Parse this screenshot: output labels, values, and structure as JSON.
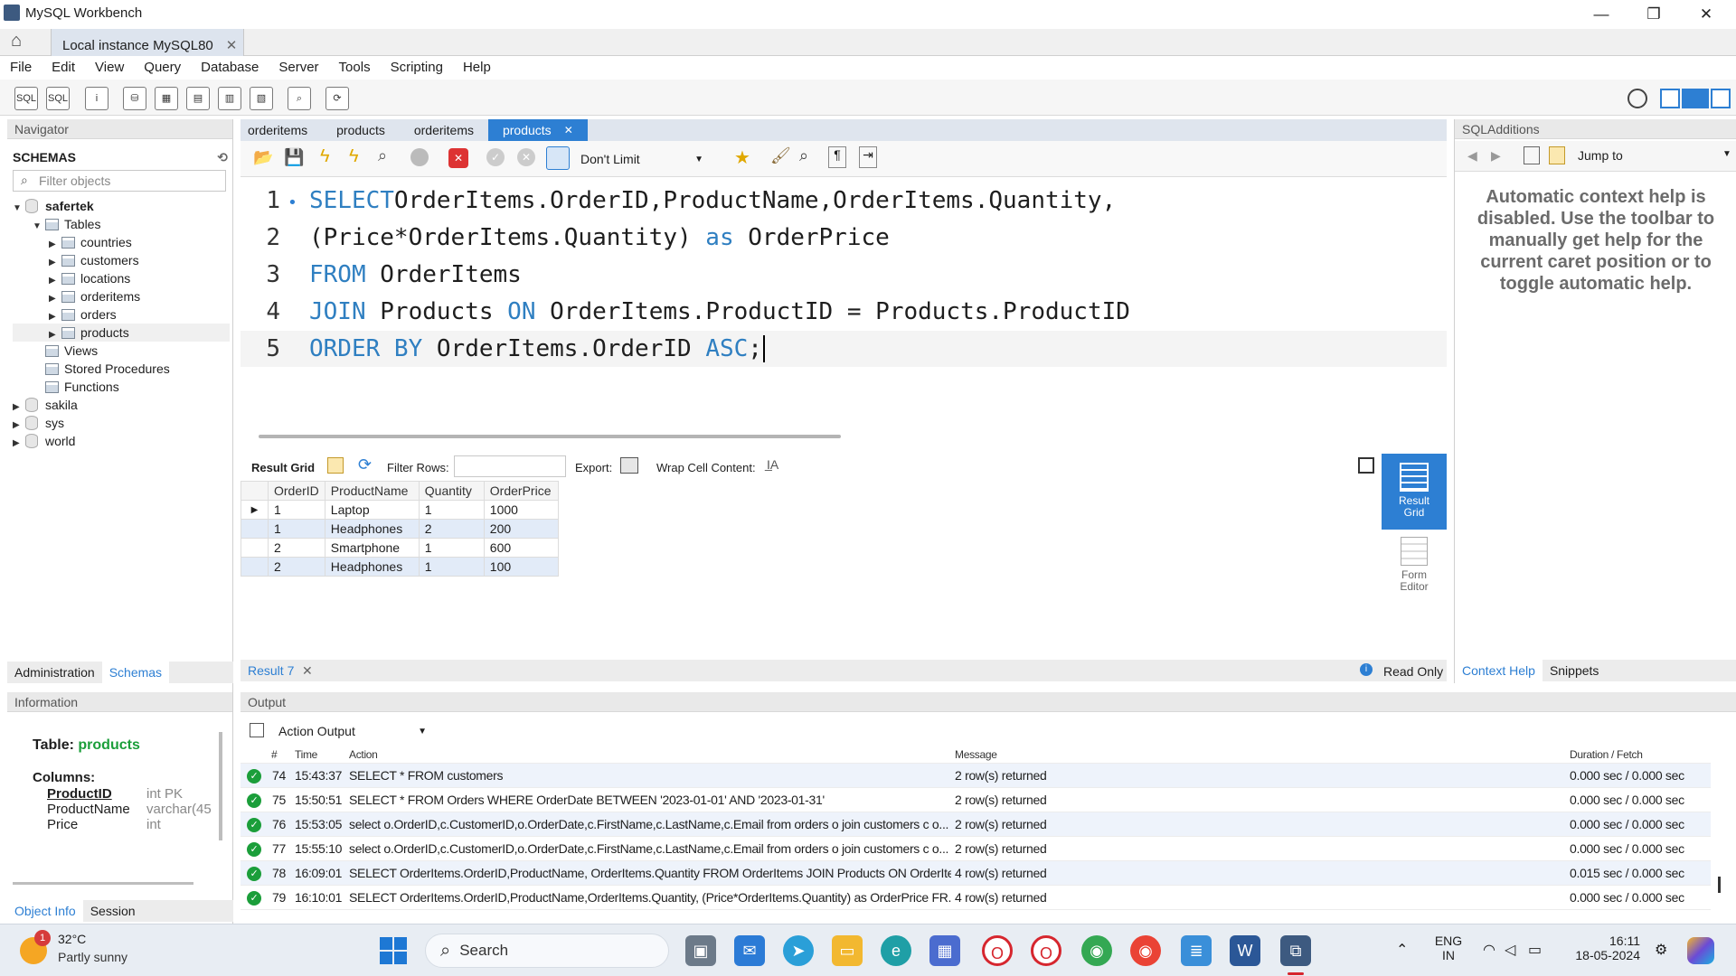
{
  "window": {
    "title": "MySQL Workbench",
    "conn_tab": "Local instance MySQL80"
  },
  "menu": [
    "File",
    "Edit",
    "View",
    "Query",
    "Database",
    "Server",
    "Tools",
    "Scripting",
    "Help"
  ],
  "navigator": {
    "header": "Navigator",
    "schemas_label": "SCHEMAS",
    "filter_placeholder": "Filter objects",
    "schema": "safertek",
    "tables_label": "Tables",
    "tables": [
      "countries",
      "customers",
      "locations",
      "orderitems",
      "orders",
      "products"
    ],
    "views_label": "Views",
    "procs_label": "Stored Procedures",
    "funcs_label": "Functions",
    "other_schemas": [
      "sakila",
      "sys",
      "world"
    ],
    "tabs": [
      "Administration",
      "Schemas"
    ]
  },
  "editor_tabs": [
    "orderitems",
    "products",
    "orderitems",
    "products"
  ],
  "limit_select": "Don't Limit",
  "sql_lines": [
    {
      "n": "1",
      "parts": [
        [
          "kw",
          "SELECT"
        ],
        [
          "",
          "OrderItems.OrderID,ProductName,OrderItems.Quantity,"
        ]
      ]
    },
    {
      "n": "2",
      "parts": [
        [
          "",
          "(Price*OrderItems.Quantity) "
        ],
        [
          "kw",
          "as"
        ],
        [
          "",
          " OrderPrice"
        ]
      ]
    },
    {
      "n": "3",
      "parts": [
        [
          "kw",
          "FROM"
        ],
        [
          "",
          " OrderItems"
        ]
      ]
    },
    {
      "n": "4",
      "parts": [
        [
          "kw",
          "JOIN"
        ],
        [
          "",
          " Products "
        ],
        [
          "kw",
          "ON"
        ],
        [
          "",
          " OrderItems.ProductID = Products.ProductID"
        ]
      ]
    },
    {
      "n": "5",
      "parts": [
        [
          "kw",
          "ORDER BY"
        ],
        [
          "",
          " OrderItems.OrderID "
        ],
        [
          "kw",
          "ASC"
        ],
        [
          "",
          ";"
        ]
      ]
    }
  ],
  "result_toolbar": {
    "grid_label": "Result Grid",
    "filter_label": "Filter Rows:",
    "export_label": "Export:",
    "wrap_label": "Wrap Cell Content:"
  },
  "result": {
    "columns": [
      "OrderID",
      "ProductName",
      "Quantity",
      "OrderPrice"
    ],
    "rows": [
      [
        "1",
        "Laptop",
        "1",
        "1000"
      ],
      [
        "1",
        "Headphones",
        "2",
        "200"
      ],
      [
        "2",
        "Smartphone",
        "1",
        "600"
      ],
      [
        "2",
        "Headphones",
        "1",
        "100"
      ]
    ]
  },
  "side_buttons": {
    "grid": "Result Grid",
    "form": "Form Editor"
  },
  "result_tab": "Result 7",
  "read_only": "Read Only",
  "sql_additions": {
    "header": "SQLAdditions",
    "jump_to": "Jump to",
    "help_text": "Automatic context help is disabled. Use the toolbar to manually get help for the current caret position or to toggle automatic help.",
    "tabs": [
      "Context Help",
      "Snippets"
    ]
  },
  "info": {
    "header": "Information",
    "table_label": "Table:",
    "table_name": "products",
    "columns_label": "Columns:",
    "cols": [
      [
        "ProductID",
        "int PK"
      ],
      [
        "ProductName",
        "varchar(45"
      ],
      [
        "Price",
        "int"
      ]
    ],
    "tabs": [
      "Object Info",
      "Session"
    ]
  },
  "output": {
    "header": "Output",
    "mode": "Action Output",
    "headers": [
      "#",
      "Time",
      "Action",
      "Message",
      "Duration / Fetch"
    ],
    "rows": [
      [
        "74",
        "15:43:37",
        "SELECT * FROM customers",
        "2 row(s) returned",
        "0.000 sec / 0.000 sec"
      ],
      [
        "75",
        "15:50:51",
        "SELECT * FROM Orders WHERE OrderDate BETWEEN '2023-01-01' AND '2023-01-31'",
        "2 row(s) returned",
        "0.000 sec / 0.000 sec"
      ],
      [
        "76",
        "15:53:05",
        "select o.OrderID,c.CustomerID,o.OrderDate,c.FirstName,c.LastName,c.Email  from orders o  join customers c o...",
        "2 row(s) returned",
        "0.000 sec / 0.000 sec"
      ],
      [
        "77",
        "15:55:10",
        "select o.OrderID,c.CustomerID,o.OrderDate,c.FirstName,c.LastName,c.Email  from orders o  join customers c o...",
        "2 row(s) returned",
        "0.000 sec / 0.000 sec"
      ],
      [
        "78",
        "16:09:01",
        "SELECT OrderItems.OrderID,ProductName, OrderItems.Quantity FROM OrderItems JOIN Products ON OrderIte...",
        "4 row(s) returned",
        "0.015 sec / 0.000 sec"
      ],
      [
        "79",
        "16:10:01",
        "SELECT OrderItems.OrderID,ProductName,OrderItems.Quantity, (Price*OrderItems.Quantity) as OrderPrice FR...",
        "4 row(s) returned",
        "0.000 sec / 0.000 sec"
      ]
    ]
  },
  "taskbar": {
    "temp": "32°C",
    "weather": "Partly sunny",
    "search": "Search",
    "lang1": "ENG",
    "lang2": "IN",
    "time": "16:11",
    "date": "18-05-2024",
    "notif_count": "1"
  }
}
